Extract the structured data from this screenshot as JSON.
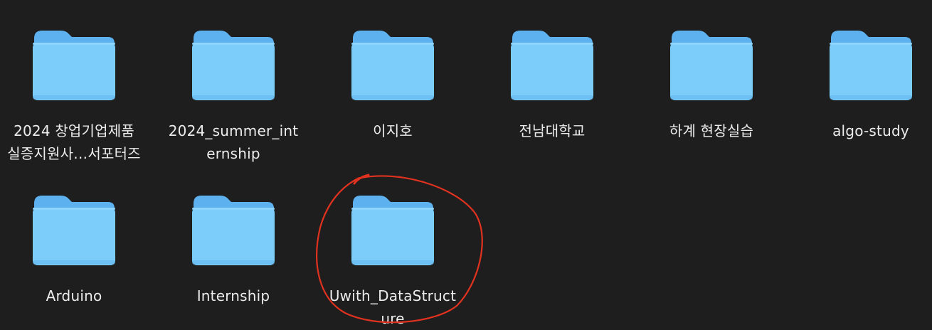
{
  "folders": [
    {
      "name": "2024 창업기업제품\n실증지원사…서포터즈"
    },
    {
      "name": "2024_summer_int\nernship"
    },
    {
      "name": "이지호"
    },
    {
      "name": "전남대학교"
    },
    {
      "name": "하계 현장실습"
    },
    {
      "name": "algo-study"
    },
    {
      "name": "Arduino"
    },
    {
      "name": "Internship"
    },
    {
      "name": "Uwith_DataStruct\nure"
    }
  ],
  "icon": "folder-icon",
  "colors": {
    "background": "#1e1e1e",
    "folder_body": "#7ccdfa",
    "folder_tab": "#5eb1ef",
    "text": "#ececec",
    "annotation": "#e0321f"
  }
}
